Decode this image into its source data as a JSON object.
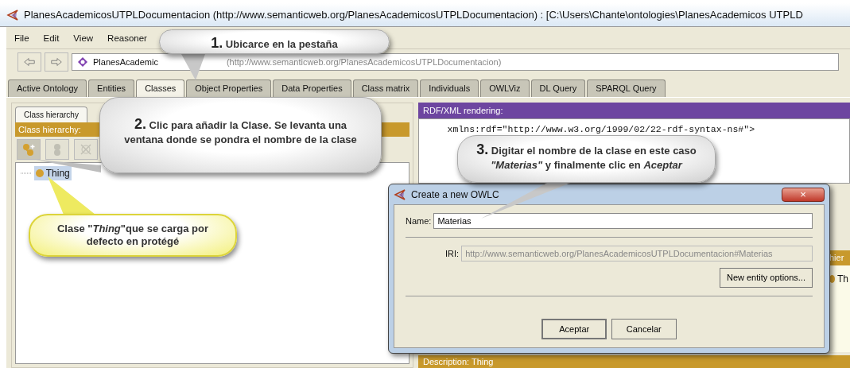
{
  "window": {
    "title": "PlanesAcademicosUTPLDocumentacion (http://www.semanticweb.org/PlanesAcademicosUTPLDocumentacion)  : [C:\\Users\\Chante\\ontologies\\PlanesAcademicos UTPLD"
  },
  "menu": [
    "File",
    "Edit",
    "View",
    "Reasoner"
  ],
  "address": {
    "name": "PlanesAcademic",
    "iri": "(http://www.semanticweb.org/PlanesAcademicosUTPLDocumentacion)"
  },
  "tabs": [
    {
      "label": "Active Ontology",
      "selected": false
    },
    {
      "label": "Entities",
      "selected": false
    },
    {
      "label": "Classes",
      "selected": true
    },
    {
      "label": "Object Properties",
      "selected": false
    },
    {
      "label": "Data Properties",
      "selected": false
    },
    {
      "label": "Class matrix",
      "selected": false
    },
    {
      "label": "Individuals",
      "selected": false
    },
    {
      "label": "OWLViz",
      "selected": false
    },
    {
      "label": "DL Query",
      "selected": false
    },
    {
      "label": "SPARQL Query",
      "selected": false
    }
  ],
  "class_hierarchy": {
    "tab": "Class hierarchy",
    "header": "Class hierarchy:",
    "tools": [
      {
        "kind": "add-subclass",
        "disabled": false
      },
      {
        "kind": "add-sibling",
        "disabled": true
      },
      {
        "kind": "delete",
        "disabled": true
      }
    ],
    "tree": [
      {
        "label": "Thing",
        "selected": true
      }
    ]
  },
  "rdf_view": {
    "header": "RDF/XML rendering:",
    "lines": [
      "    xmlns:rdf=\"http://www.w3.org/1999/02/22-rdf-syntax-ns#\">"
    ]
  },
  "side_panel": {
    "header": "hier",
    "items": [
      "Th"
    ]
  },
  "description": {
    "header": "Description: Thing"
  },
  "dialog": {
    "title": "Create a new OWLC",
    "close": "×",
    "name_label": "Name:",
    "name_value": "Materias",
    "iri_label": "IRI:",
    "iri_value": "http://www.semanticweb.org/PlanesAcademicosUTPLDocumentacion#Materias",
    "options_button": "New entity options...",
    "buttons": [
      "Aceptar",
      "Cancelar"
    ]
  },
  "callouts": [
    {
      "kind": "gray",
      "number": "1.",
      "text": "Ubicarce en la pestaña"
    },
    {
      "kind": "gray",
      "number": "2.",
      "text": "Clic para añadir la Clase. Se levanta una ventana donde se pondra el nombre de la clase"
    },
    {
      "kind": "gray",
      "number": "3.",
      "text": "Digitar el nombre de la clase  en este caso *\"Materias\"* y finalmente clic en *Aceptar*"
    },
    {
      "kind": "yellow",
      "text": "Clase \"*Thing*\"que se carga por defecto en protégé"
    }
  ]
}
